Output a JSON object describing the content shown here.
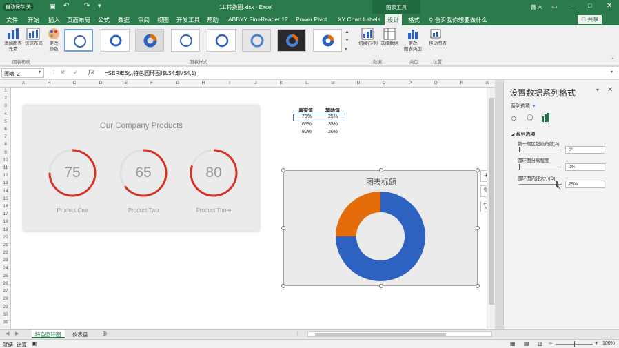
{
  "titlebar": {
    "save_label": "自动保存",
    "save_state": "关",
    "doc_title": "11.转换圈.xlsx - Excel",
    "context": "图表工具",
    "user": "薇 木",
    "accent": "#2b7a4b"
  },
  "menu": {
    "file": "文件",
    "tabs": [
      "开始",
      "插入",
      "页面布局",
      "公式",
      "数据",
      "审阅",
      "视图",
      "开发工具",
      "帮助",
      "ABBYY FineReader 12",
      "Power Pivot",
      "XY Chart Labels",
      "设计",
      "格式"
    ],
    "tellme": "告诉我你想要做什么",
    "share": "共享"
  },
  "ribbon": {
    "add_element": "添加图表\n元素",
    "quick_layout": "快速布局",
    "change_colors": "更改\n颜色",
    "layout_group": "图表布局",
    "styles_group": "图表样式",
    "switch_rowcol": "切换行/列",
    "select_data": "选择数据",
    "data_group": "数据",
    "change_type": "更改\n图表类型",
    "type_group": "类型",
    "move_chart": "移动图表",
    "location_group": "位置"
  },
  "formulabar": {
    "namebox": "图表 2",
    "formula": "=SERIES(,,特色圆环图!$L$4:$M$4,1)"
  },
  "columns": [
    "A",
    "H",
    "C",
    "D",
    "E",
    "F",
    "G",
    "H",
    "I",
    "J",
    "K",
    "L",
    "M",
    "N",
    "O",
    "P",
    "Q",
    "R",
    "S"
  ],
  "rows": [
    "1",
    "2",
    "3",
    "4",
    "5",
    "6",
    "7",
    "8",
    "9",
    "10",
    "11",
    "12",
    "13",
    "14",
    "15",
    "16",
    "17",
    "18",
    "19",
    "20",
    "21",
    "22",
    "23",
    "24",
    "25",
    "26",
    "27",
    "28",
    "29",
    "30",
    "31"
  ],
  "table": {
    "headers": [
      "真实值",
      "辅助值"
    ],
    "rows": [
      [
        "75%",
        "25%"
      ],
      [
        "65%",
        "35%"
      ],
      [
        "80%",
        "20%"
      ]
    ]
  },
  "card": {
    "title": "Our Company Products",
    "gauges": [
      {
        "value": "75",
        "label": "Product One",
        "fraction": 0.75
      },
      {
        "value": "65",
        "label": "Product Two",
        "fraction": 0.65
      },
      {
        "value": "80",
        "label": "Product Three",
        "fraction": 0.8
      }
    ],
    "ring_color": "#d93025"
  },
  "chart": {
    "title": "图表标题",
    "fraction": 0.25,
    "series_colors": [
      "#e46c0a",
      "#2e62c0"
    ]
  },
  "chart_data": {
    "type": "pie",
    "title": "图表标题",
    "categories": [
      "真实值",
      "辅助值"
    ],
    "values": [
      75,
      25
    ],
    "hole": 0.75
  },
  "pane": {
    "title": "设置数据系列格式",
    "section": "系列选项",
    "subsection": "系列选项",
    "angle_label": "第一扇区起始角度(A)",
    "angle_value": "0°",
    "explode_label": "圆环图分离程度",
    "explode_value": "0%",
    "hole_label": "圆环图内径大小(D)",
    "hole_value": "75%"
  },
  "sheets": [
    "特色圆环图",
    "仪表盘"
  ],
  "status": {
    "left": "就绪",
    "mode": "计算",
    "zoom": "100%"
  }
}
